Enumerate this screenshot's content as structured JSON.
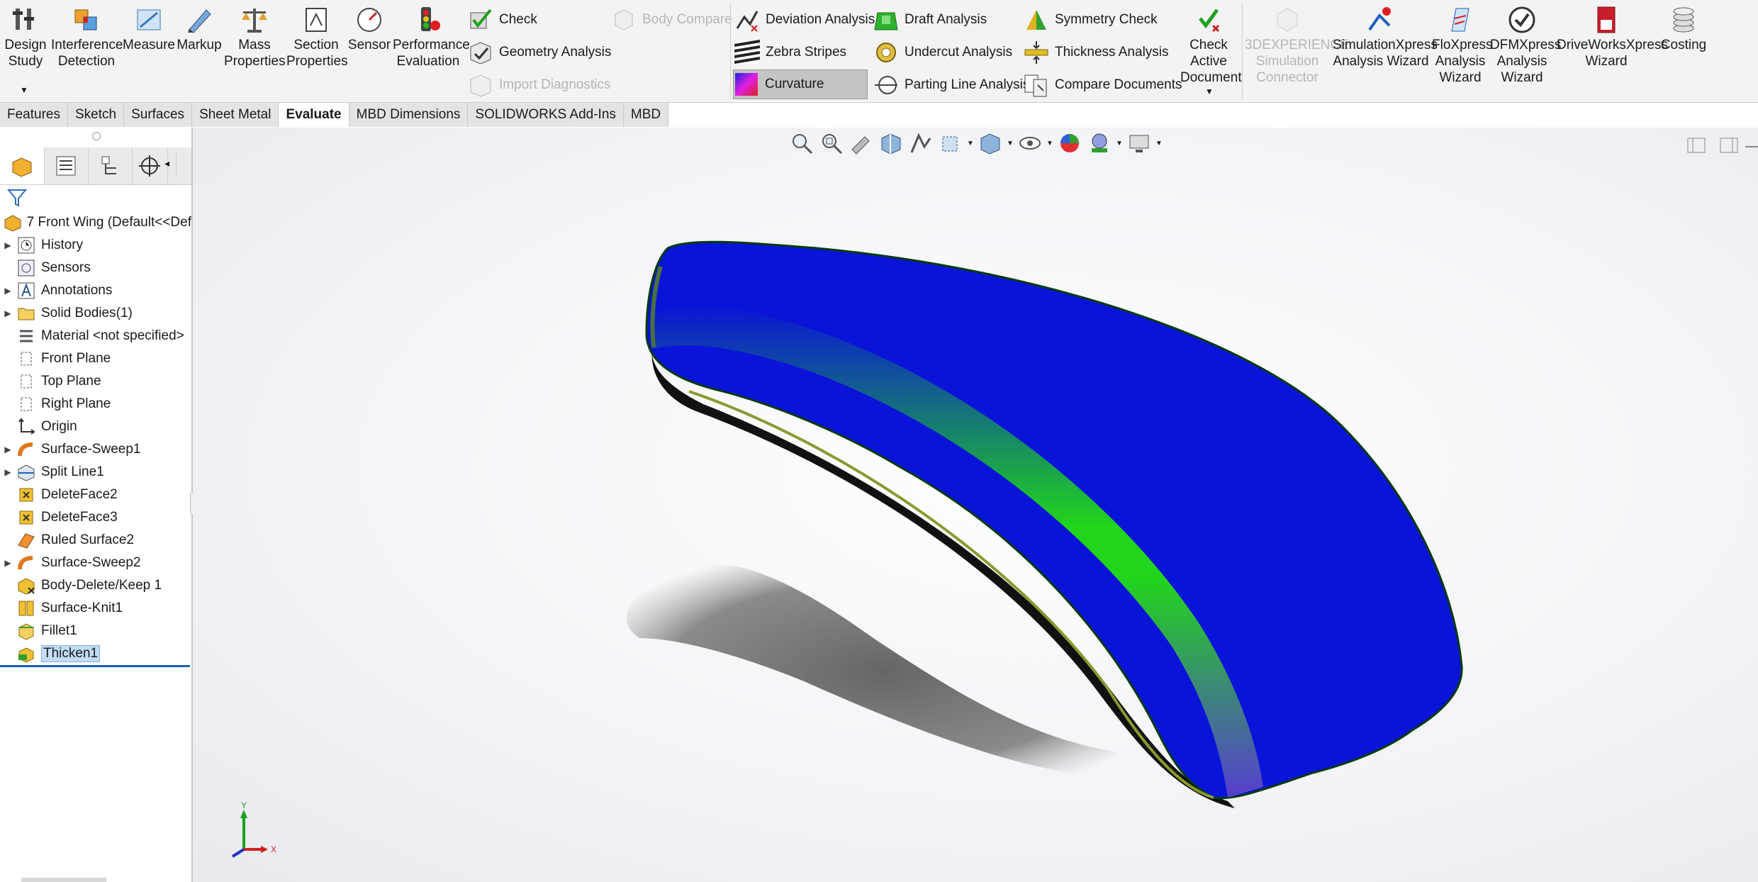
{
  "ribbon": {
    "design_study": "Design Study",
    "interference_detection": "Interference Detection",
    "measure": "Measure",
    "markup": "Markup",
    "mass_properties": "Mass Properties",
    "section_properties": "Section Properties",
    "sensor": "Sensor",
    "performance_evaluation": "Performance Evaluation",
    "check": "Check",
    "geometry_analysis": "Geometry Analysis",
    "import_diagnostics": "Import Diagnostics",
    "body_compare": "Body Compare",
    "deviation_analysis": "Deviation Analysis",
    "zebra_stripes": "Zebra Stripes",
    "curvature": "Curvature",
    "draft_analysis": "Draft Analysis",
    "undercut_analysis": "Undercut Analysis",
    "parting_line_analysis": "Parting Line Analysis",
    "symmetry_check": "Symmetry Check",
    "thickness_analysis": "Thickness Analysis",
    "compare_documents": "Compare Documents",
    "check_active_document": "Check Active Document",
    "sim_connector": "3DEXPERIENCE Simulation Connector",
    "simxpress": "SimulationXpress Analysis Wizard",
    "floxpress": "FloXpress Analysis Wizard",
    "dfmxpress": "DFMXpress Analysis Wizard",
    "driveworks": "DriveWorksXpress Wizard",
    "costing": "Costing"
  },
  "tabs": [
    "Features",
    "Sketch",
    "Surfaces",
    "Sheet Metal",
    "Evaluate",
    "MBD Dimensions",
    "SOLIDWORKS Add-Ins",
    "MBD"
  ],
  "active_tab": "Evaluate",
  "tree": {
    "root": "7 Front Wing  (Default<<Def",
    "items": [
      "History",
      "Sensors",
      "Annotations",
      "Solid Bodies(1)",
      "Material <not specified>",
      "Front Plane",
      "Top Plane",
      "Right Plane",
      "Origin",
      "Surface-Sweep1",
      "Split Line1",
      "DeleteFace2",
      "DeleteFace3",
      "Ruled Surface2",
      "Surface-Sweep2",
      "Body-Delete/Keep 1",
      "Surface-Knit1",
      "Fillet1",
      "Thicken1"
    ]
  },
  "triad": {
    "y": "Y",
    "x": "X"
  },
  "colors": {
    "accent": "#1a5fb4",
    "model_blue": "#0a14d8",
    "model_green": "#22e010",
    "selected": "#c3dcf5"
  }
}
